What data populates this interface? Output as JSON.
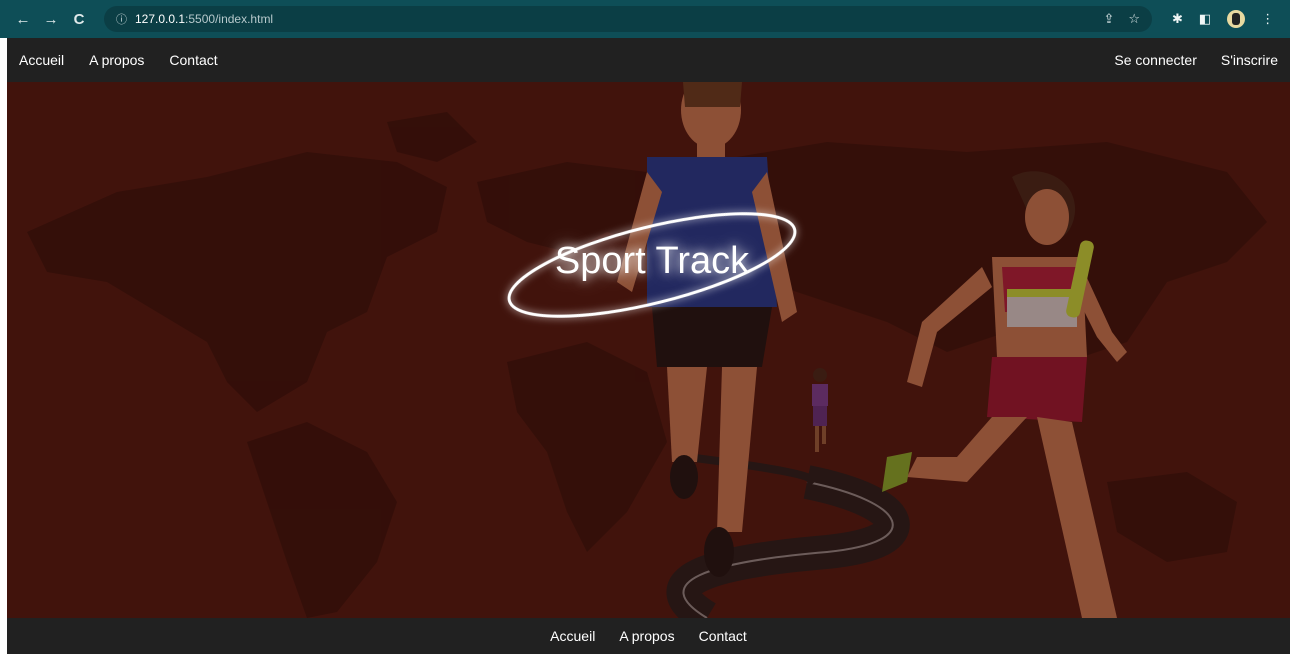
{
  "browser": {
    "url_host": "127.0.0.1",
    "url_path": ":5500/index.html",
    "back_icon": "←",
    "forward_icon": "→",
    "reload_icon": "C",
    "info_icon": "ⓘ"
  },
  "header": {
    "left_links": [
      "Accueil",
      "A propos",
      "Contact"
    ],
    "right_links": [
      "Se connecter",
      "S'inscrire"
    ]
  },
  "hero": {
    "title": "Sport Track",
    "background_color": "#44160f"
  },
  "footer": {
    "links": [
      "Accueil",
      "A propos",
      "Contact"
    ]
  },
  "colors": {
    "browser_bar": "#0e4e57",
    "nav_bar": "#212121",
    "hero_bg": "#44160f"
  }
}
